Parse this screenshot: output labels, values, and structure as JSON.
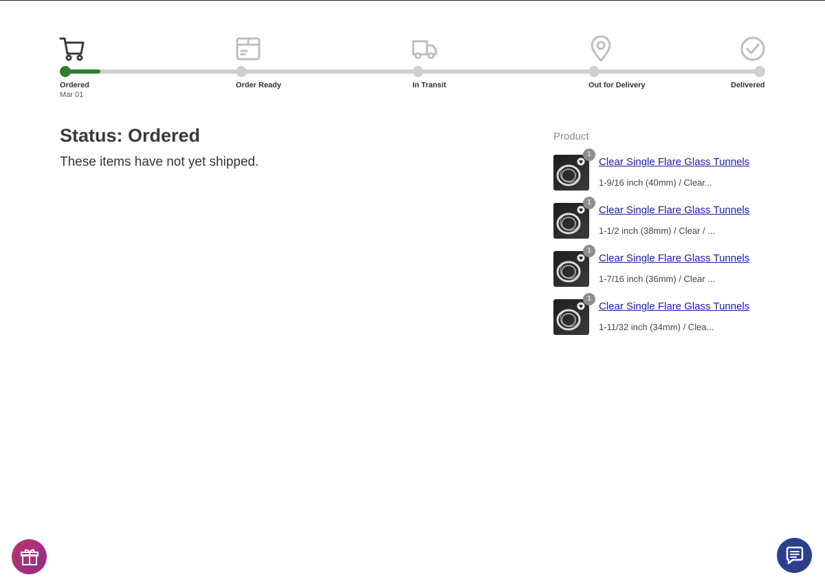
{
  "tracker": {
    "progress": 0.05,
    "steps": [
      {
        "label": "Ordered",
        "date": "Mar 01",
        "icon": "cart-icon",
        "active": true
      },
      {
        "label": "Order Ready",
        "date": "",
        "icon": "box-icon",
        "active": false
      },
      {
        "label": "In Transit",
        "date": "",
        "icon": "truck-icon",
        "active": false
      },
      {
        "label": "Out for Delivery",
        "date": "",
        "icon": "map-pin-icon",
        "active": false
      },
      {
        "label": "Delivered",
        "date": "",
        "icon": "check-circle-icon",
        "active": false
      }
    ]
  },
  "status": {
    "title": "Status: Ordered",
    "message": "These items have not yet shipped."
  },
  "products": {
    "header": "Product",
    "items": [
      {
        "name": "Clear Single Flare Glass Tunnels",
        "variant": "1-9/16 inch (40mm) / Clear...",
        "qty": "1"
      },
      {
        "name": "Clear Single Flare Glass Tunnels",
        "variant": "1-1/2 inch (38mm) / Clear / ...",
        "qty": "1"
      },
      {
        "name": "Clear Single Flare Glass Tunnels",
        "variant": "1-7/16 inch (36mm) / Clear ...",
        "qty": "1"
      },
      {
        "name": "Clear Single Flare Glass Tunnels",
        "variant": "1-11/32 inch (34mm) / Clea...",
        "qty": "1"
      }
    ]
  },
  "colors": {
    "progress_active": "#2e7d32",
    "progress_inactive": "#cfcfcf",
    "link": "#1a1aa6",
    "gift_button": "#b3337a",
    "chat_button": "#2c3f8f"
  },
  "floating": {
    "gift_icon": "gift-icon",
    "chat_icon": "chat-icon"
  }
}
